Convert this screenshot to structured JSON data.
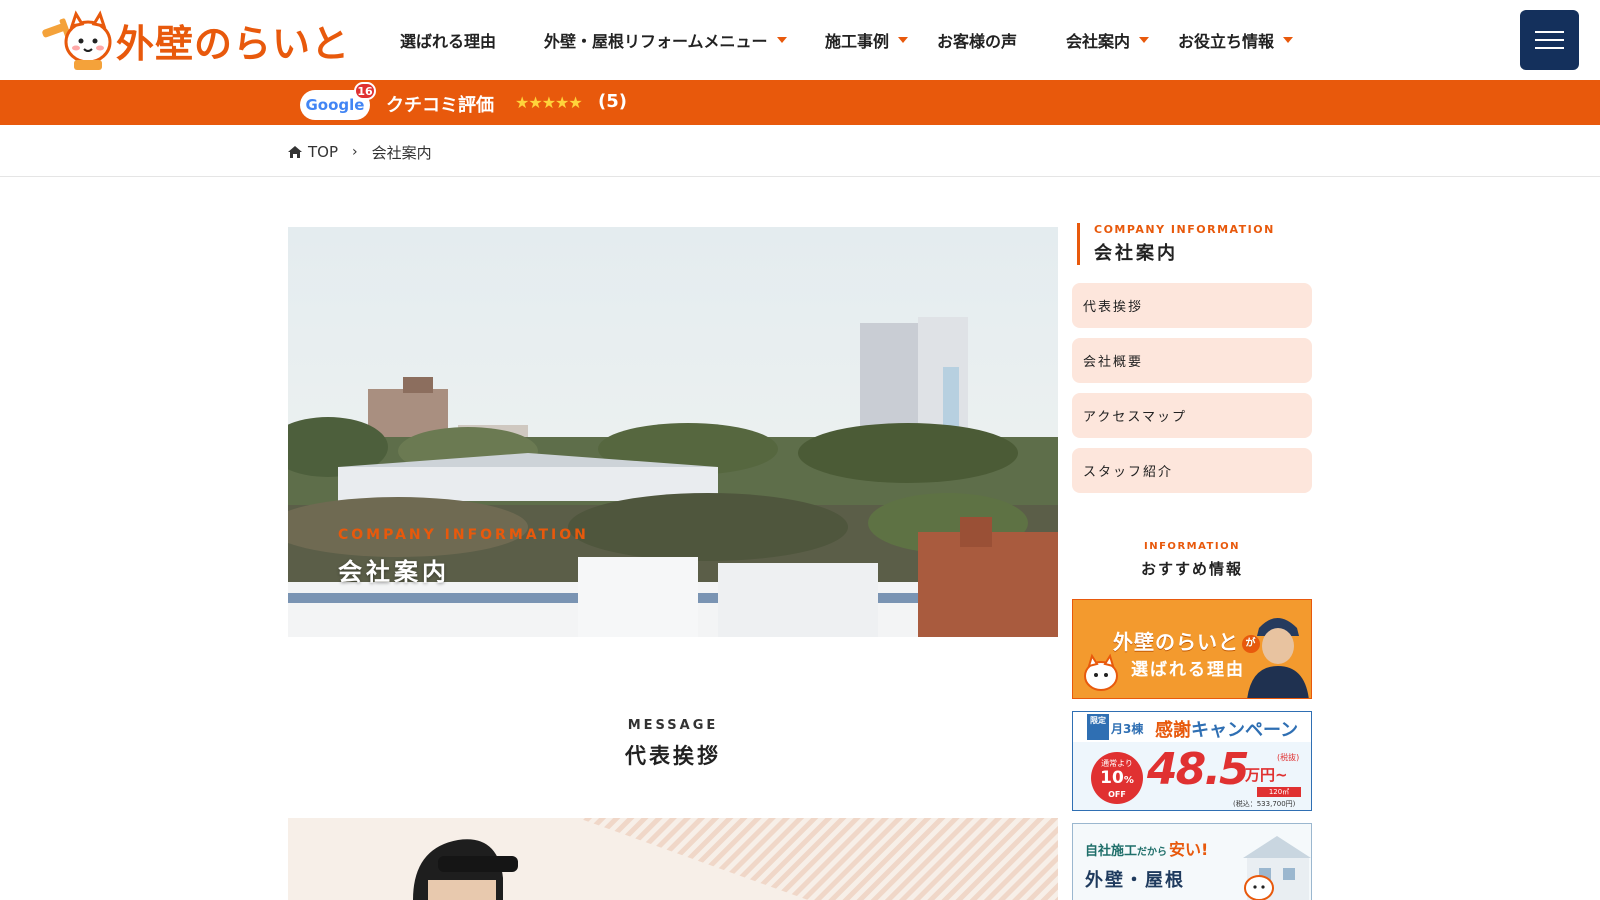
{
  "header": {
    "logo_text": "外壁のらいと",
    "nav": [
      {
        "label": "選ばれる理由",
        "dropdown": false
      },
      {
        "label": "外壁・屋根リフォームメニュー",
        "dropdown": true
      },
      {
        "label": "施工事例",
        "dropdown": true
      },
      {
        "label": "お客様の声",
        "dropdown": false
      },
      {
        "label": "会社案内",
        "dropdown": true
      },
      {
        "label": "お役立ち情報",
        "dropdown": true
      }
    ],
    "menu_icon": "hamburger-icon"
  },
  "review_bar": {
    "google_label": "Google",
    "google_count": "16",
    "label": "クチコミ評価",
    "stars": "★★★★★",
    "score": "(5)"
  },
  "breadcrumb": {
    "home_label": "TOP",
    "current": "会社案内"
  },
  "hero": {
    "subtitle": "COMPANY INFORMATION",
    "title": "会社案内"
  },
  "message": {
    "subtitle": "MESSAGE",
    "title": "代表挨拶"
  },
  "sidebar": {
    "subtitle": "COMPANY INFORMATION",
    "title": "会社案内",
    "links": [
      "代表挨拶",
      "会社概要",
      "アクセスマップ",
      "スタッフ紹介"
    ],
    "info_subtitle": "INFORMATION",
    "info_title": "おすすめ情報",
    "banners": {
      "reason": {
        "line1": "外壁のらいと",
        "line1_suffix": "が",
        "line2": "選ばれる理由"
      },
      "campaign": {
        "limited": "限定",
        "monthly": "月3棟",
        "title_a": "感謝",
        "title_b": "キャンペーン",
        "normal": "通常より",
        "off_pct": "10",
        "off_unit": "%",
        "off": "OFF",
        "price": "48.5",
        "price_unit": "万円~",
        "tax": "(税抜)",
        "area": "120㎡",
        "tax_in": "(税込：533,700円)"
      },
      "self": {
        "line1a": "自社施工",
        "line1b": "だから",
        "line1c": "安い!",
        "line2": "外壁・屋根"
      }
    }
  },
  "colors": {
    "brand": "#e8590c",
    "navy": "#14305c",
    "pale": "#fde6dc"
  }
}
